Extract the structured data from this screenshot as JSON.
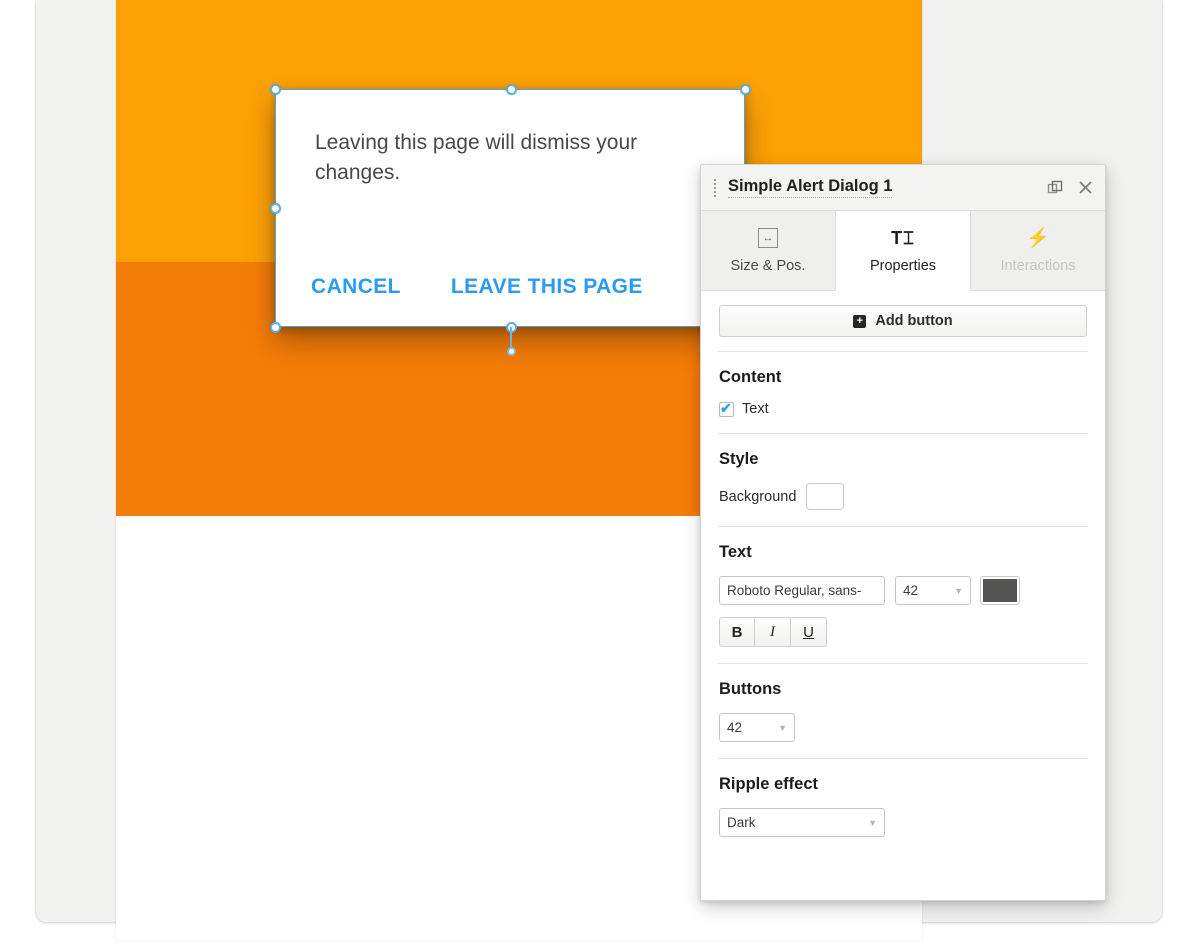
{
  "canvas": {
    "band_top_color": "#fca006",
    "band_bottom_color": "#f47c08",
    "page_bg_color": "#f1f1f0"
  },
  "alert_dialog": {
    "message": "Leaving this page will dismiss your changes.",
    "buttons": [
      {
        "label": "CANCEL"
      },
      {
        "label": "LEAVE THIS PAGE"
      }
    ],
    "button_color": "#2b9af3",
    "text_color": "#484848"
  },
  "panel": {
    "title": "Simple Alert Dialog 1",
    "drag_handle_icon": "drag-dots-icon",
    "duplicate_icon": "duplicate-icon",
    "close_icon": "close-icon",
    "tabs": [
      {
        "label": "Size & Pos.",
        "icon": "resize-horizontal-icon",
        "glyph": "↔",
        "active": false,
        "disabled": false
      },
      {
        "label": "Properties",
        "icon": "text-cursor-icon",
        "glyph": "T",
        "active": true,
        "disabled": false
      },
      {
        "label": "Interactions",
        "icon": "lightning-bolt-icon",
        "glyph": "⚡",
        "active": false,
        "disabled": true
      }
    ],
    "add_button": {
      "label": "Add button",
      "icon": "plus-square-icon",
      "glyph": "+"
    },
    "sections": {
      "content": {
        "title": "Content",
        "text_checkbox": {
          "label": "Text",
          "checked": true
        }
      },
      "style": {
        "title": "Style",
        "background": {
          "label": "Background",
          "value": "#ffffff"
        }
      },
      "text": {
        "title": "Text",
        "font_family": "Roboto Regular, sans-",
        "font_size": "42",
        "color": "#555553",
        "bold_label": "B",
        "italic_label": "I",
        "underline_label": "U"
      },
      "buttons": {
        "title": "Buttons",
        "size": "42"
      },
      "ripple": {
        "title": "Ripple effect",
        "value": "Dark"
      }
    }
  }
}
